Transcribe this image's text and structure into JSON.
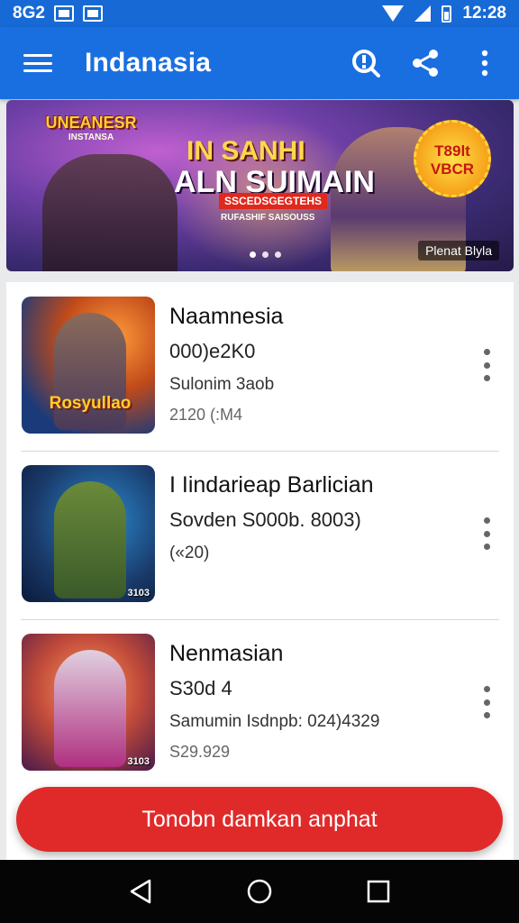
{
  "status_bar": {
    "left_text": "8G2",
    "time": "12:28"
  },
  "app_bar": {
    "title": "Indanasia"
  },
  "banner": {
    "logo_text": "UNEANESR",
    "logo_sub": "INSTANSA",
    "title_line1": "IN SANHI",
    "title_line2": "ALN SUIMAIN",
    "tag1": "SSCEDSGEGTEHS",
    "tag2": "RUFASHIF SAISOUSS",
    "badge": "T89lt VBCR",
    "caption": "Plenat Blyla",
    "dots": 3,
    "active_dot": 0
  },
  "items": [
    {
      "title": "Naamnesia",
      "subtitle": "000)e2K0",
      "meta": "Sulonim 3aob",
      "foot": "2120 (:M4",
      "thumb_logo": "Rosyullao",
      "thumb_label": ""
    },
    {
      "title": "I Iindarieap Barlician",
      "subtitle": "Sovden S000b. 8003)",
      "meta": "(«20)",
      "foot": "",
      "thumb_logo": "",
      "thumb_label": "3103"
    },
    {
      "title": "Nenmasian",
      "subtitle": "S30d 4",
      "meta": "Samumin Isdnpb: 024)4329",
      "foot": "S29.929",
      "thumb_logo": "",
      "thumb_label": "3103"
    }
  ],
  "cta": {
    "label": "Tonobn damkan anphat"
  },
  "colors": {
    "primary": "#1a6fe0",
    "cta": "#e02a2a",
    "nav": "#050505"
  }
}
